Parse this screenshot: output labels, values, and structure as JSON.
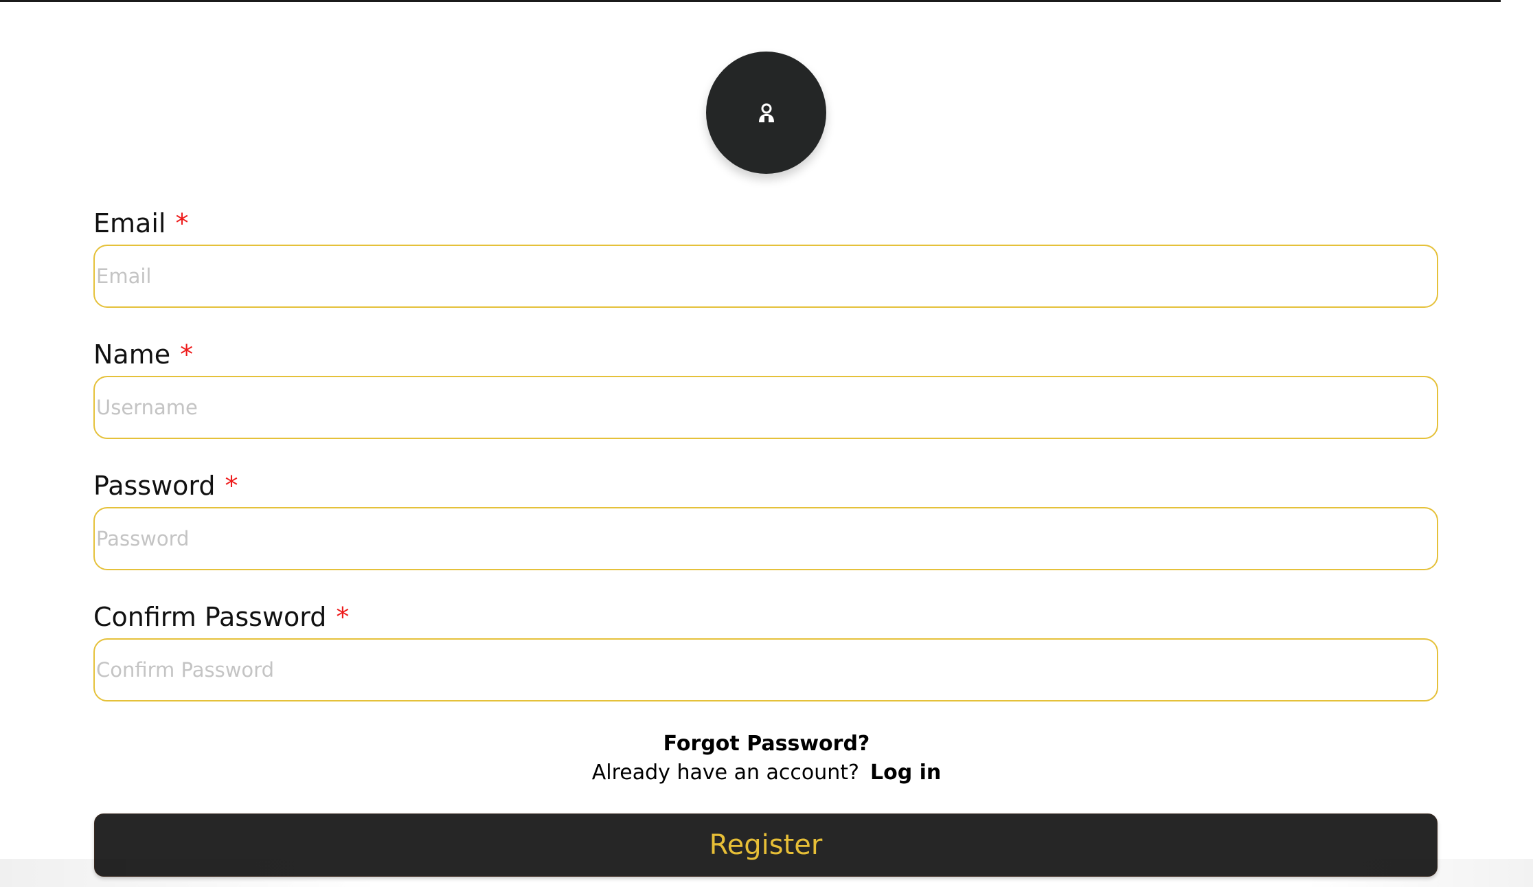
{
  "avatar": {
    "icon": "user-icon",
    "bg_color": "#242626"
  },
  "form": {
    "fields": [
      {
        "label": "Email",
        "required_mark": "*",
        "placeholder": "Email",
        "value": ""
      },
      {
        "label": "Name",
        "required_mark": "*",
        "placeholder": "Username",
        "value": ""
      },
      {
        "label": "Password",
        "required_mark": "*",
        "placeholder": "Password",
        "value": ""
      },
      {
        "label": "Confirm Password",
        "required_mark": "*",
        "placeholder": "Confirm Password",
        "value": ""
      }
    ],
    "forgot_password": "Forgot Password?",
    "login_prompt": "Already have an account?",
    "login_link": "Log in",
    "register_label": "Register"
  },
  "colors": {
    "accent": "#e5c13a",
    "required": "#ee1b1b",
    "button_bg": "#262626",
    "button_text": "#e7bf37"
  }
}
